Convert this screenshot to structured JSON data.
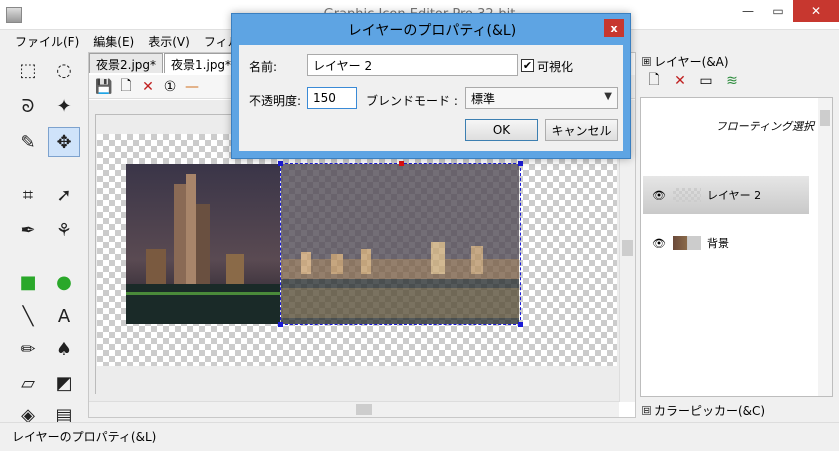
{
  "window": {
    "title": "Graphic Icon Editor Pro 32-bit"
  },
  "menu": [
    "ファイル(F)",
    "編集(E)",
    "表示(V)",
    "フィルター"
  ],
  "tabs": [
    {
      "label": "夜景2.jpg*",
      "active": false
    },
    {
      "label": "夜景1.jpg*",
      "active": true
    }
  ],
  "tools": [
    {
      "name": "rect-select-icon",
      "glyph": "⬚"
    },
    {
      "name": "ellipse-select-icon",
      "glyph": "◌"
    },
    {
      "name": "lasso-icon",
      "glyph": "ᘐ"
    },
    {
      "name": "magic-wand-icon",
      "glyph": "✦"
    },
    {
      "name": "free-draw-icon",
      "glyph": "✎"
    },
    {
      "name": "move-icon",
      "glyph": "✥",
      "selected": true
    },
    {
      "name": "crop-icon",
      "glyph": "⌗"
    },
    {
      "name": "pointer-icon",
      "glyph": "➚"
    },
    {
      "name": "eyedropper-icon",
      "glyph": "✒"
    },
    {
      "name": "fill-icon",
      "glyph": "⚘"
    },
    {
      "name": "rectangle-icon",
      "glyph": "■"
    },
    {
      "name": "ellipse-icon",
      "glyph": "●"
    },
    {
      "name": "line-icon",
      "glyph": "╲"
    },
    {
      "name": "text-icon",
      "glyph": "A"
    },
    {
      "name": "pencil-icon",
      "glyph": "✏"
    },
    {
      "name": "brush-icon",
      "glyph": "♠"
    },
    {
      "name": "eraser-icon",
      "glyph": "▱"
    },
    {
      "name": "color-swap-icon",
      "glyph": "◩"
    },
    {
      "name": "bucket-icon",
      "glyph": "◈"
    },
    {
      "name": "gradient-icon",
      "glyph": "▤"
    }
  ],
  "doc_toolbar": [
    {
      "name": "save-icon",
      "glyph": "💾"
    },
    {
      "name": "new-page-icon",
      "glyph": "🗋"
    },
    {
      "name": "delete-icon",
      "glyph": "✕"
    },
    {
      "name": "actual-size-icon",
      "glyph": "①"
    },
    {
      "name": "line-tool-icon",
      "glyph": "—"
    }
  ],
  "layer_panel": {
    "header": "レイヤー(&A)",
    "toolbar": [
      {
        "name": "new-layer-icon",
        "glyph": "🗋"
      },
      {
        "name": "delete-layer-icon",
        "glyph": "✕"
      },
      {
        "name": "layer-properties-icon",
        "glyph": "▭"
      },
      {
        "name": "merge-layers-icon",
        "glyph": "≋"
      }
    ],
    "floating_selection": "フローティング選択",
    "layers": [
      {
        "name": "レイヤー 2",
        "selected": true,
        "thumb": "transparent"
      },
      {
        "name": "背景",
        "selected": false,
        "thumb": "photo"
      }
    ],
    "color_picker_header": "カラーピッカー(&C)"
  },
  "status": "レイヤーのプロパティ(&L)",
  "dialog": {
    "title": "レイヤーのプロパティ(&L)",
    "name_label": "名前:",
    "name_value": "レイヤー 2",
    "visible_label": "可視化",
    "visible_checked": "✔",
    "opacity_label": "不透明度:",
    "opacity_value": "150",
    "blend_label": "ブレンドモード :",
    "blend_value": "標準",
    "ok_label": "OK",
    "cancel_label": "キャンセル"
  },
  "colors": {
    "dialog_frame": "#5ea4e3",
    "selection": "#1b1bd6",
    "close_red": "#c7372f"
  }
}
